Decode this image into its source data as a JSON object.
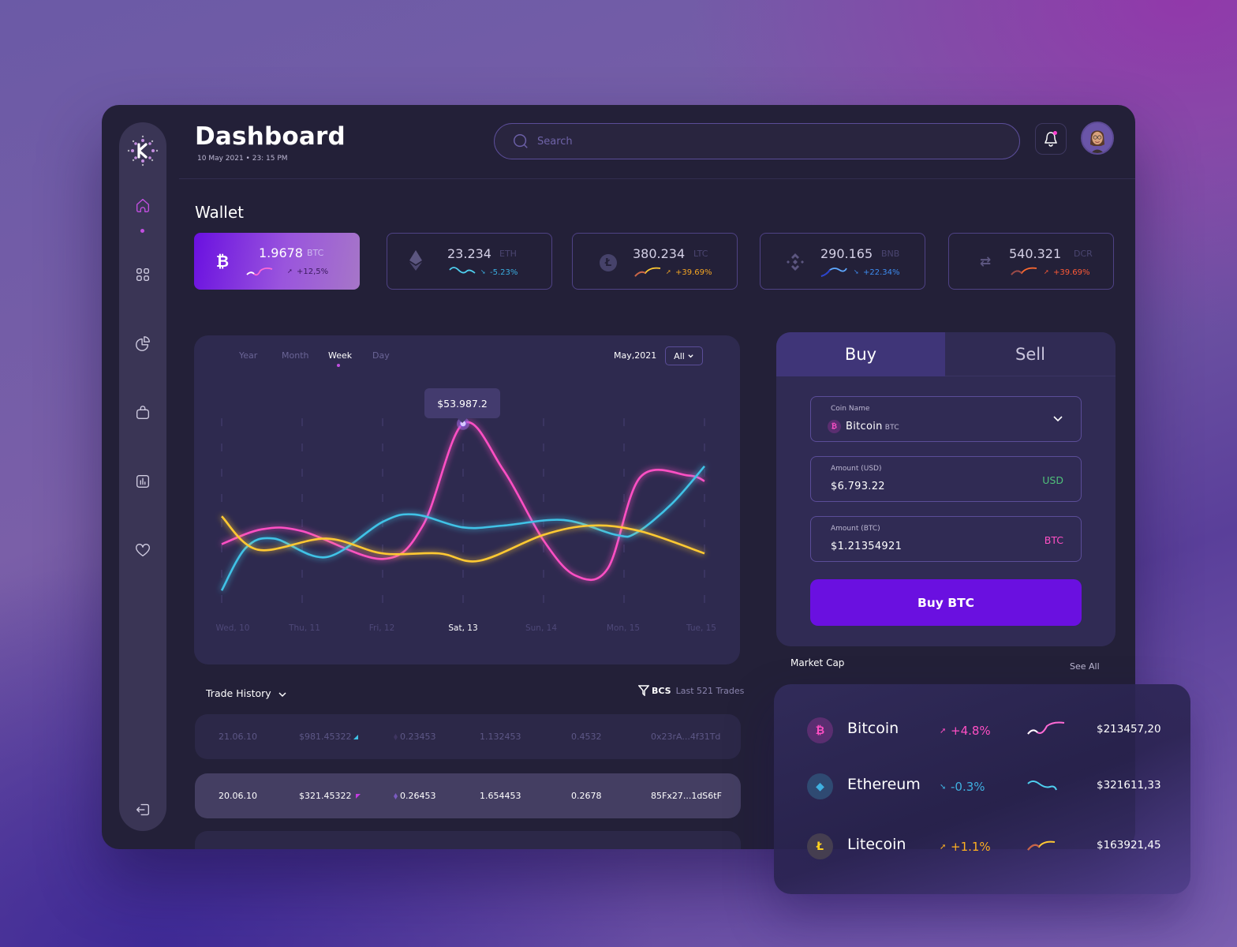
{
  "header": {
    "title": "Dashboard",
    "datetime": "10 May 2021 • 23: 15 PM",
    "search_placeholder": "Search"
  },
  "sidebar": {
    "items": [
      {
        "name": "home",
        "active": true
      },
      {
        "name": "apps"
      },
      {
        "name": "analytics"
      },
      {
        "name": "wallet"
      },
      {
        "name": "reports"
      },
      {
        "name": "favorites"
      },
      {
        "name": "logout"
      }
    ]
  },
  "wallet": {
    "title": "Wallet",
    "cards": [
      {
        "icon": "bitcoin-icon",
        "value": "1.9678",
        "ticker": "BTC",
        "change": "+12,5%",
        "direction": "up",
        "color": "#4a1a70",
        "active": true
      },
      {
        "icon": "ethereum-icon",
        "value": "23.234",
        "ticker": "ETH",
        "change": "-5.23%",
        "direction": "down",
        "color": "#3aaee0"
      },
      {
        "icon": "litecoin-icon",
        "value": "380.234",
        "ticker": "LTC",
        "change": "+39.69%",
        "direction": "up",
        "color": "#f5a623"
      },
      {
        "icon": "binance-icon",
        "value": "290.165",
        "ticker": "BNB",
        "change": "+22.34%",
        "direction": "down",
        "color": "#3d8cf0"
      },
      {
        "icon": "decred-icon",
        "value": "540.321",
        "ticker": "DCR",
        "change": "+39.69%",
        "direction": "up",
        "color": "#ff5a36"
      }
    ]
  },
  "chart": {
    "tabs": [
      "Year",
      "Month",
      "Week",
      "Day"
    ],
    "active_tab": "Week",
    "period": "May,2021",
    "filter": "All",
    "tooltip": "$53.987.2"
  },
  "chart_data": {
    "type": "line",
    "title": "",
    "x": [
      "Wed, 10",
      "Thu, 11",
      "Fri, 12",
      "Sat, 13",
      "Sun, 14",
      "Mon, 15",
      "Tue, 15"
    ],
    "highlight_x": "Sat, 13",
    "highlight_value": "$53.987.2",
    "ylim": [
      0,
      100
    ],
    "grid": "vertical-dashed",
    "series": [
      {
        "name": "pink",
        "color": "#ff4fc4",
        "values": [
          {
            "x": 0,
            "y": 30
          },
          {
            "x": 0.5,
            "y": 38
          },
          {
            "x": 1,
            "y": 37
          },
          {
            "x": 2,
            "y": 22
          },
          {
            "x": 2.5,
            "y": 40
          },
          {
            "x": 3,
            "y": 95
          },
          {
            "x": 3.5,
            "y": 70
          },
          {
            "x": 4,
            "y": 32
          },
          {
            "x": 4.4,
            "y": 13
          },
          {
            "x": 4.8,
            "y": 17
          },
          {
            "x": 5.2,
            "y": 66
          },
          {
            "x": 5.8,
            "y": 67
          },
          {
            "x": 6,
            "y": 64
          }
        ]
      },
      {
        "name": "cyan",
        "color": "#3fc2e6",
        "values": [
          {
            "x": 0,
            "y": 5
          },
          {
            "x": 0.3,
            "y": 28
          },
          {
            "x": 0.65,
            "y": 33
          },
          {
            "x": 1.3,
            "y": 23
          },
          {
            "x": 2,
            "y": 42
          },
          {
            "x": 2.4,
            "y": 46
          },
          {
            "x": 3,
            "y": 39
          },
          {
            "x": 3.5,
            "y": 40
          },
          {
            "x": 4.25,
            "y": 43
          },
          {
            "x": 4.9,
            "y": 35
          },
          {
            "x": 5.15,
            "y": 36
          },
          {
            "x": 5.6,
            "y": 52
          },
          {
            "x": 6,
            "y": 72
          }
        ]
      },
      {
        "name": "yellow",
        "color": "#ffc933",
        "values": [
          {
            "x": 0,
            "y": 45
          },
          {
            "x": 0.45,
            "y": 27
          },
          {
            "x": 1.3,
            "y": 33
          },
          {
            "x": 2,
            "y": 25
          },
          {
            "x": 2.7,
            "y": 25
          },
          {
            "x": 3.2,
            "y": 21
          },
          {
            "x": 4,
            "y": 35
          },
          {
            "x": 4.6,
            "y": 40
          },
          {
            "x": 5.2,
            "y": 37
          },
          {
            "x": 6,
            "y": 25
          }
        ]
      }
    ]
  },
  "trade_history": {
    "title": "Trade History",
    "filter_label": "BCS",
    "count_label": "Last 521 Trades",
    "rows": [
      {
        "date": "21.06.10",
        "price": "$981.45322",
        "trend": "up",
        "amount": "0.23453",
        "total": "1.132453",
        "fee": "0.4532",
        "address": "0x23rA...4f31Td",
        "highlight": false
      },
      {
        "date": "20.06.10",
        "price": "$321.45322",
        "trend": "down",
        "amount": "0.26453",
        "total": "1.654453",
        "fee": "0.2678",
        "address": "85Fx27...1dS6tF",
        "highlight": true
      }
    ]
  },
  "trade_panel": {
    "tabs": [
      "Buy",
      "Sell"
    ],
    "active_tab": "Buy",
    "coin_label": "Coin Name",
    "coin_name": "Bitcoin",
    "coin_ticker": "BTC",
    "usd_label": "Amount (USD)",
    "usd_value": "$6.793.22",
    "usd_unit": "USD",
    "btc_label": "Amount (BTC)",
    "btc_value": "$1.21354921",
    "btc_unit": "BTC",
    "button_label": "Buy BTC",
    "accent": "#6a10e0"
  },
  "market_cap": {
    "title": "Market Cap",
    "see_all": "See All",
    "rows": [
      {
        "name": "Bitcoin",
        "change": "+4.8%",
        "direction": "up",
        "price": "$213457,20",
        "color": "#ff4fc4",
        "icon": "bitcoin-icon"
      },
      {
        "name": "Ethereum",
        "change": "-0.3%",
        "direction": "down",
        "price": "$321611,33",
        "color": "#3fb0e0",
        "icon": "ethereum-icon"
      },
      {
        "name": "Litecoin",
        "change": "+1.1%",
        "direction": "up",
        "price": "$163921,45",
        "color": "#ffb020",
        "icon": "litecoin-icon"
      }
    ]
  }
}
